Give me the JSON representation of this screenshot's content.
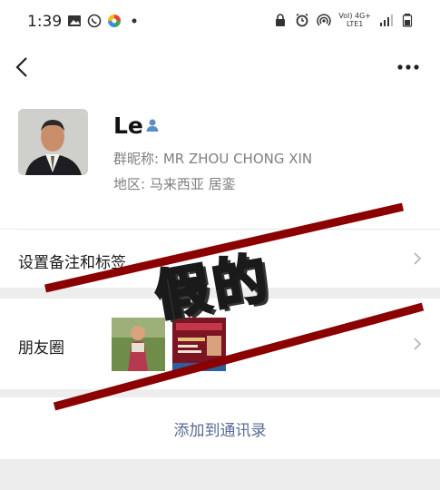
{
  "status_bar": {
    "time": "1:39",
    "net_top": "Vol) 4G+",
    "net_bottom": "LTE1"
  },
  "profile": {
    "name": "Le",
    "nickname": "群昵称: MR ZHOU CHONG XIN",
    "region": "地区: 马来西亚  居銮"
  },
  "rows": {
    "remark_label": "设置备注和标签",
    "moments_label": "朋友圈"
  },
  "actions": {
    "add_contact": "添加到通讯录"
  },
  "overlay": {
    "stamp_text": "假的"
  },
  "colors": {
    "link_blue": "#576b95",
    "stamp_red": "#b0000e",
    "line_red": "#8b0000"
  }
}
